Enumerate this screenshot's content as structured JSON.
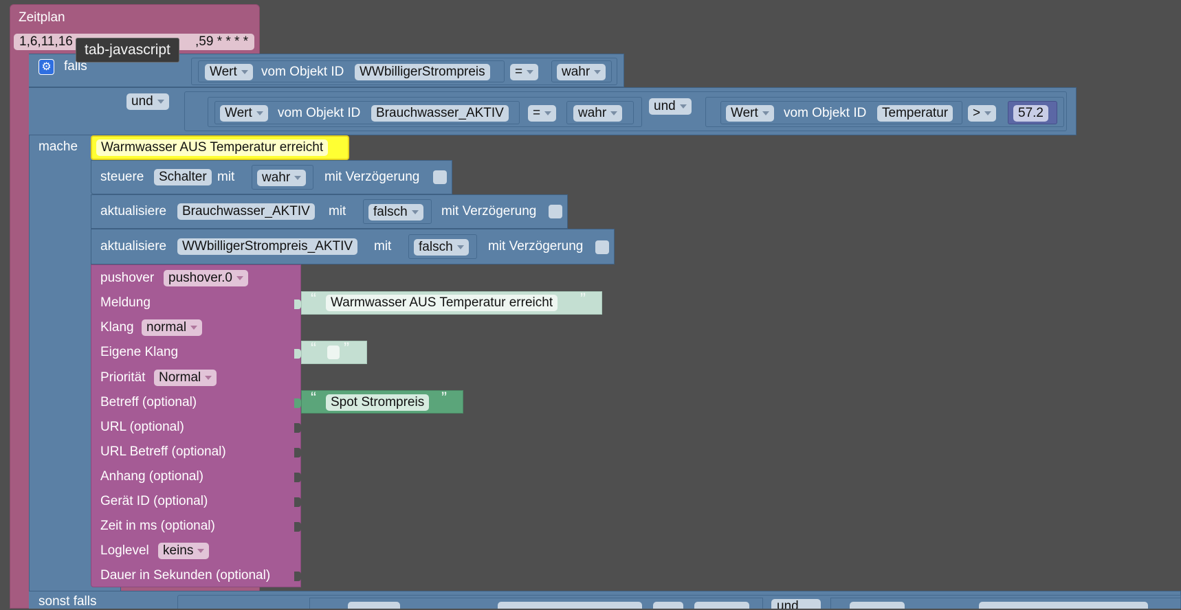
{
  "tooltip": "tab-javascript",
  "zeitplan": {
    "label": "Zeitplan",
    "cron_visible": "1,6,11,16",
    "cron_tail": ",59 * * * *"
  },
  "falls": {
    "label": "falls"
  },
  "cond1": {
    "value_dd": "Wert",
    "from_object": "vom Objekt ID",
    "object_id": "WWbilligerStrompreis",
    "op": "=",
    "bool": "wahr"
  },
  "und_outer": "und",
  "cond2": {
    "value_dd": "Wert",
    "from_object": "vom Objekt ID",
    "object_id": "Brauchwasser_AKTIV",
    "op": "=",
    "bool": "wahr"
  },
  "und_inner": "und",
  "cond3": {
    "value_dd": "Wert",
    "from_object": "vom Objekt ID",
    "object_id": "Temperatur",
    "op": ">",
    "number": "57.2"
  },
  "mache": "mache",
  "comment": "Warmwasser AUS Temperatur erreicht",
  "steuere": {
    "label": "steuere",
    "target": "Schalter",
    "mit": "mit",
    "value": "wahr",
    "delay_label": "mit Verzögerung"
  },
  "akt1": {
    "label": "aktualisiere",
    "target": "Brauchwasser_AKTIV",
    "mit": "mit",
    "value": "falsch",
    "delay_label": "mit Verzögerung"
  },
  "akt2": {
    "label": "aktualisiere",
    "target": "WWbilligerStrompreis_AKTIV",
    "mit": "mit",
    "value": "falsch",
    "delay_label": "mit Verzögerung"
  },
  "pushover": {
    "label": "pushover",
    "instance": "pushover.0",
    "meldung": "Meldung",
    "meldung_text": "Warmwasser AUS Temperatur erreicht",
    "klang": "Klang",
    "klang_value": "normal",
    "eigene_klang": "Eigene Klang",
    "eigene_klang_text": "",
    "prioritaet": "Priorität",
    "prioritaet_value": "Normal",
    "betreff": "Betreff (optional)",
    "betreff_text": "Spot Strompreis",
    "url": "URL (optional)",
    "url_betreff": "URL Betreff (optional)",
    "anhang": "Anhang (optional)",
    "geraet": "Gerät ID (optional)",
    "zeit": "Zeit in ms (optional)",
    "loglevel": "Loglevel",
    "loglevel_value": "keins",
    "dauer": "Dauer in Sekunden (optional)"
  },
  "sonst_falls": "sonst falls",
  "und_bottom": "und",
  "colors": {
    "background": "#4f4f4f",
    "logic_blue": "#5b80a5",
    "pushover_purple": "#a55b95",
    "schedule_pink": "#a55b80",
    "comment_yellow": "#ffff33",
    "text_green": "#7fb59a"
  },
  "icons": {
    "gear": "gear-icon",
    "quote_open": "quote-open-icon",
    "quote_close": "quote-close-icon"
  }
}
